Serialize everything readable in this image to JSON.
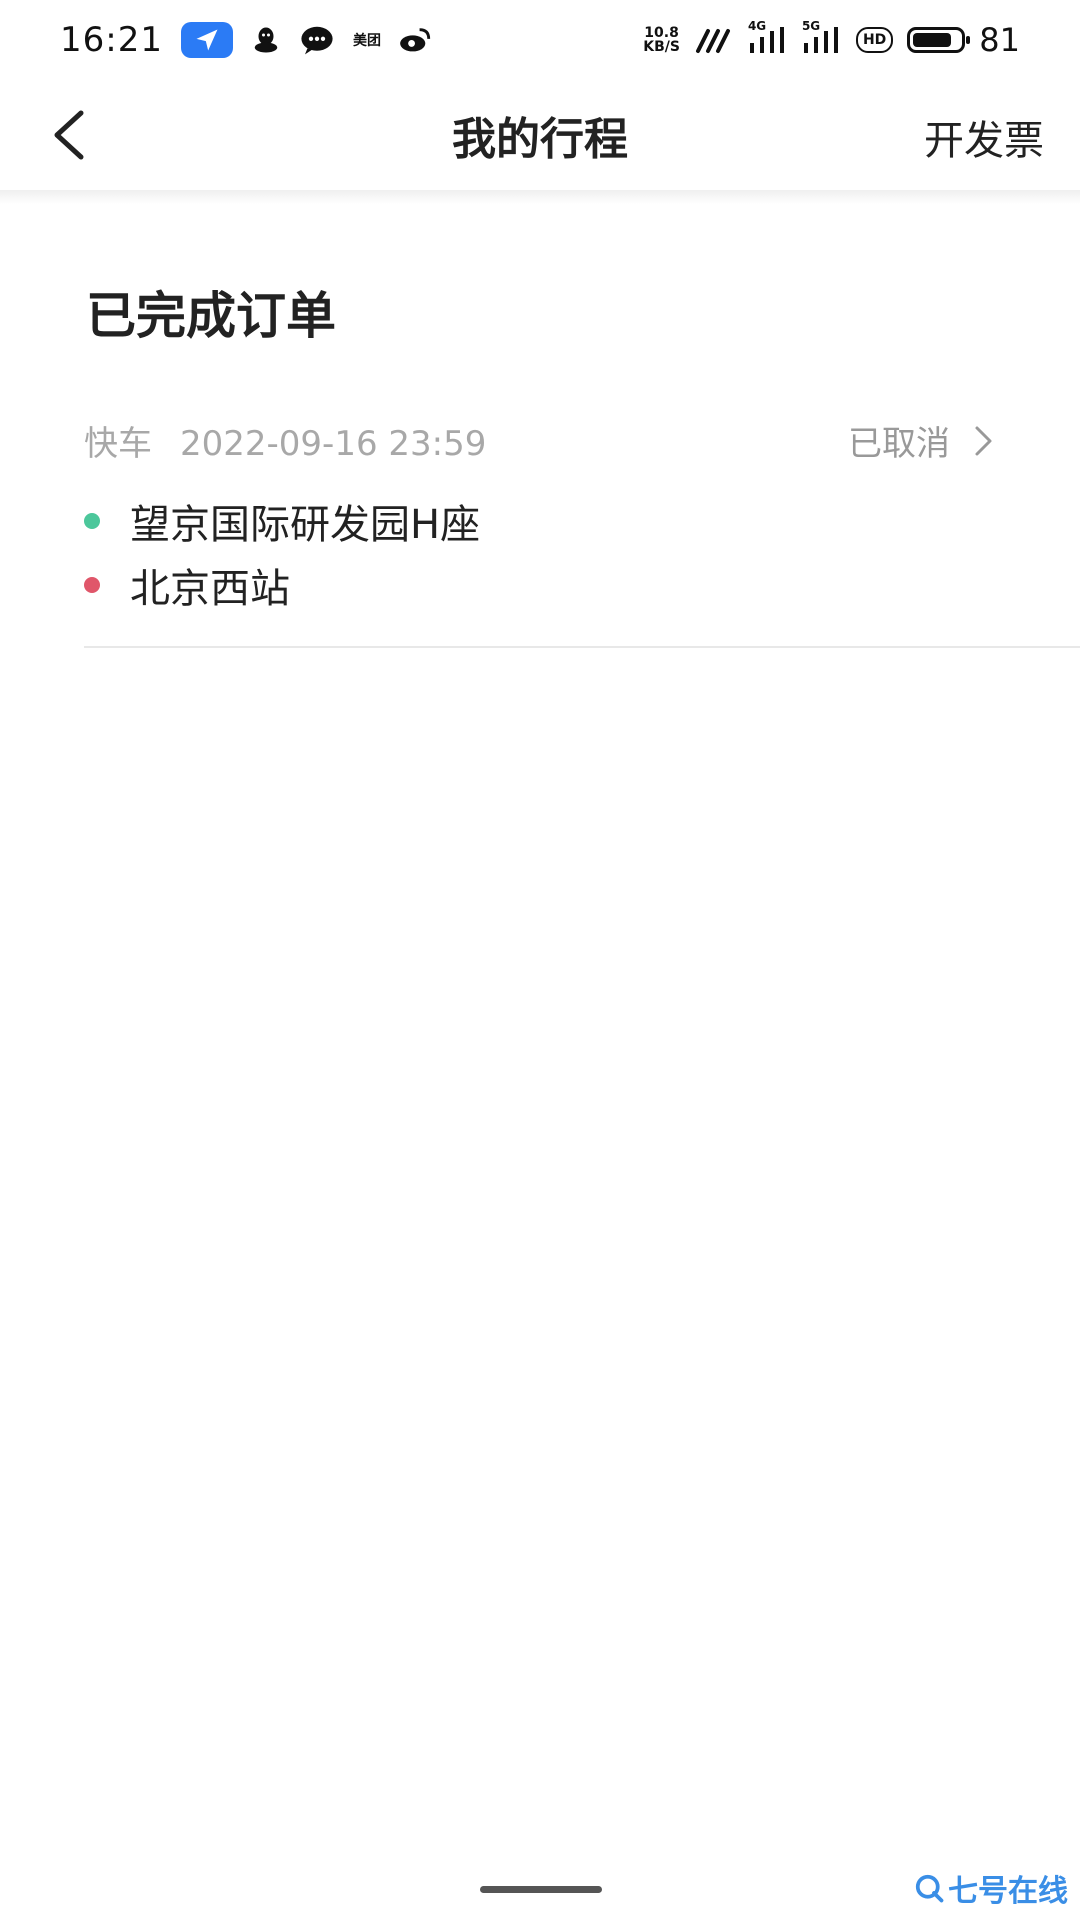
{
  "status_bar": {
    "time": "16:21",
    "meituan_label": "美团",
    "net_speed_value": "10.8",
    "net_speed_unit": "KB/S",
    "signal_4g_label": "4G",
    "signal_5g_label": "5G",
    "hd_label": "HD",
    "battery_percent": "81",
    "icons": [
      "location-arrow-icon",
      "qq-icon",
      "wechat-icon",
      "meituan-icon",
      "weibo-icon",
      "wifi-icon",
      "signal-4g-icon",
      "signal-5g-icon",
      "hd-icon",
      "battery-icon"
    ]
  },
  "header": {
    "title": "我的行程",
    "action_label": "开发票",
    "back_icon": "chevron-left-icon"
  },
  "section": {
    "title": "已完成订单"
  },
  "orders": [
    {
      "type": "快车",
      "datetime": "2022-09-16 23:59",
      "status": "已取消",
      "origin": "望京国际研发园H座",
      "destination": "北京西站"
    }
  ],
  "colors": {
    "origin_dot": "#4cc79b",
    "destination_dot": "#e0566a",
    "nav_app_blue": "#2b7bf5",
    "watermark_blue": "#3a8ee6"
  },
  "watermark": {
    "text": "七号在线"
  }
}
